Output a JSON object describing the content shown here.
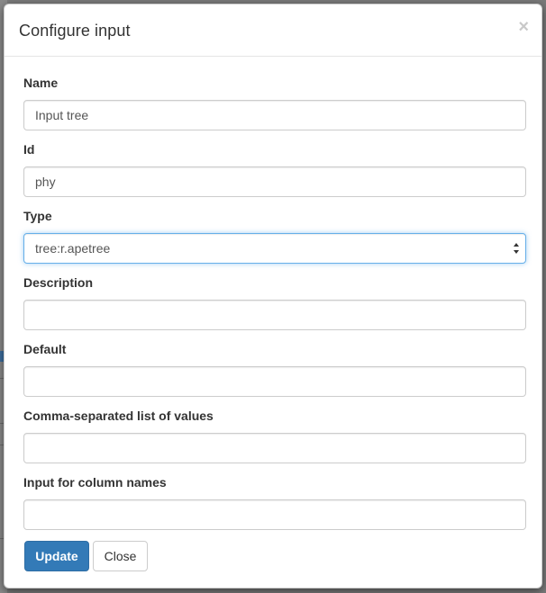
{
  "dialog": {
    "title": "Configure input",
    "close_glyph": "×"
  },
  "fields": [
    {
      "label": "Name",
      "value": "Input tree",
      "placeholder": ""
    },
    {
      "label": "Id",
      "value": "phy",
      "placeholder": ""
    },
    {
      "label": "Type",
      "value": "tree:r.apetree",
      "placeholder": ""
    },
    {
      "label": "Description",
      "value": "",
      "placeholder": ""
    },
    {
      "label": "Default",
      "value": "",
      "placeholder": ""
    },
    {
      "label": "Comma-separated list of values",
      "value": "",
      "placeholder": ""
    },
    {
      "label": "Input for column names",
      "value": "",
      "placeholder": ""
    }
  ],
  "buttons": {
    "update_label": "Update",
    "close_label": "Close"
  },
  "colors": {
    "primary": "#337ab7",
    "focus_border": "#66afe9"
  },
  "icons": {
    "close": "close-icon",
    "select": "select-arrows-icon"
  }
}
